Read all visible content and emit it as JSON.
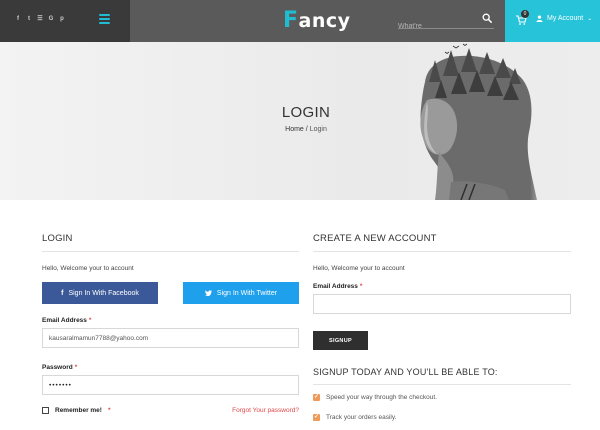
{
  "header": {
    "social_icons": [
      {
        "icon": "facebook-icon",
        "glyph": "f"
      },
      {
        "icon": "twitter-icon",
        "glyph": "t"
      },
      {
        "icon": "rss-icon",
        "glyph": "☰"
      },
      {
        "icon": "google-plus-icon",
        "glyph": "G"
      },
      {
        "icon": "pinterest-icon",
        "glyph": "p"
      }
    ],
    "logo_first": "F",
    "logo_rest": "ancy",
    "search_placeholder": "What're",
    "cart_count": "0",
    "account_label": "My Account",
    "colors": {
      "accent": "#27c3d8",
      "dark": "#3a3a3a",
      "mid": "#5a5a5a"
    }
  },
  "hero": {
    "title": "LOGIN",
    "breadcrumb_home": "Home",
    "breadcrumb_sep": "/",
    "breadcrumb_current": "Login"
  },
  "login": {
    "title": "LOGIN",
    "welcome": "Hello, Welcome your to account",
    "facebook_label": "Sign In With Facebook",
    "twitter_label": "Sign In With Twitter",
    "email_label": "Email Address",
    "email_value": "kausaralmamun7788@yahoo.com",
    "password_label": "Password",
    "password_value": "•••••••",
    "remember_label": "Remember me!",
    "required_mark": "*",
    "forgot_label": "Forgot Your password?"
  },
  "register": {
    "title": "CREATE A NEW ACCOUNT",
    "welcome": "Hello, Welcome your to account",
    "email_label": "Email Address",
    "email_value": "",
    "signup_label": "SIGNUP",
    "benefits_title": "SIGNUP TODAY AND YOU'LL BE ABLE TO:",
    "benefits": [
      "Speed your way through the checkout.",
      "Track your orders easily."
    ]
  }
}
